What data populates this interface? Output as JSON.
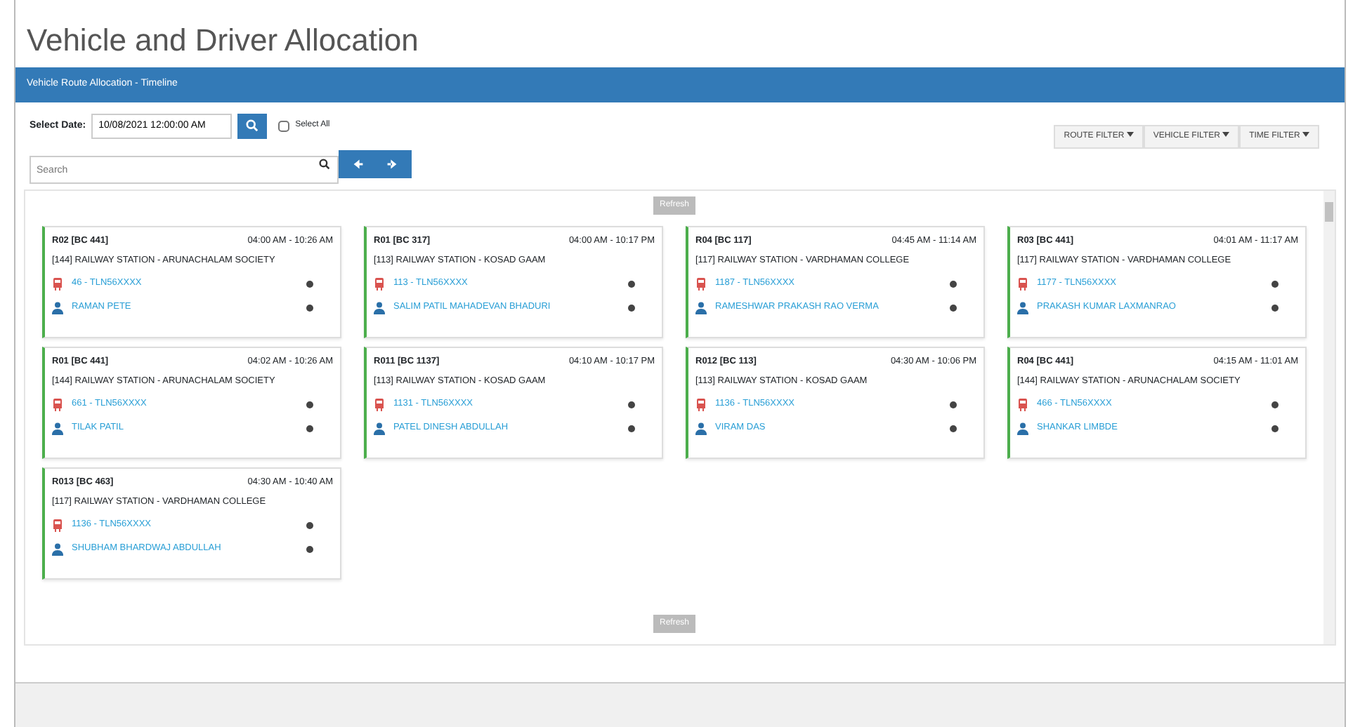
{
  "page_title": "Vehicle and Driver Allocation",
  "panel_title": "Vehicle Route Allocation - Timeline",
  "date_label": "Select Date:",
  "date_value": "10/08/2021 12:00:00 AM",
  "select_all": {
    "label": "Select All",
    "checked": false
  },
  "search": {
    "placeholder": "Search"
  },
  "filters": [
    "ROUTE FILTER",
    "VEHICLE FILTER",
    "TIME FILTER"
  ],
  "top_button": "Refresh",
  "bottom_button": "Refresh",
  "cards": [
    {
      "route": "R02 [BC 441]",
      "time": "04:00 AM - 10:26 AM",
      "stop": "[144] RAILWAY STATION - ARUNACHALAM SOCIETY",
      "vehicle": "46 - TLN56XXXX",
      "driver": "RAMAN PETE"
    },
    {
      "route": "R01 [BC 317]",
      "time": "04:00 AM - 10:17 PM",
      "stop": "[113] RAILWAY STATION - KOSAD GAAM",
      "vehicle": "113 - TLN56XXXX",
      "driver": "SALIM PATIL MAHADEVAN BHADURI"
    },
    {
      "route": "R04 [BC 117]",
      "time": "04:45 AM - 11:14 AM",
      "stop": "[117] RAILWAY STATION - VARDHAMAN COLLEGE",
      "vehicle": "1187 - TLN56XXXX",
      "driver": "RAMESHWAR PRAKASH RAO VERMA"
    },
    {
      "route": "R03 [BC 441]",
      "time": "04:01 AM - 11:17 AM",
      "stop": "[117] RAILWAY STATION - VARDHAMAN COLLEGE",
      "vehicle": "1177 - TLN56XXXX",
      "driver": "PRAKASH KUMAR LAXMANRAO"
    },
    {
      "route": "R01 [BC 441]",
      "time": "04:02 AM - 10:26 AM",
      "stop": "[144] RAILWAY STATION - ARUNACHALAM SOCIETY",
      "vehicle": "661 - TLN56XXXX",
      "driver": "TILAK PATIL"
    },
    {
      "route": "R011 [BC 1137]",
      "time": "04:10 AM - 10:17 PM",
      "stop": "[113] RAILWAY STATION - KOSAD GAAM",
      "vehicle": "1131 - TLN56XXXX",
      "driver": "PATEL DINESH ABDULLAH"
    },
    {
      "route": "R012 [BC 113]",
      "time": "04:30 AM - 10:06 PM",
      "stop": "[113] RAILWAY STATION - KOSAD GAAM",
      "vehicle": "1136 - TLN56XXXX",
      "driver": "VIRAM DAS"
    },
    {
      "route": "R04 [BC 441]",
      "time": "04:15 AM - 11:01 AM",
      "stop": "[144] RAILWAY STATION - ARUNACHALAM SOCIETY",
      "vehicle": "466 - TLN56XXXX",
      "driver": "SHANKAR LIMBDE"
    },
    {
      "route": "R013 [BC 463]",
      "time": "04:30 AM - 10:40 AM",
      "stop": "[117] RAILWAY STATION - VARDHAMAN COLLEGE",
      "vehicle": "1136 - TLN56XXXX",
      "driver": "SHUBHAM BHARDWAJ ABDULLAH"
    }
  ]
}
